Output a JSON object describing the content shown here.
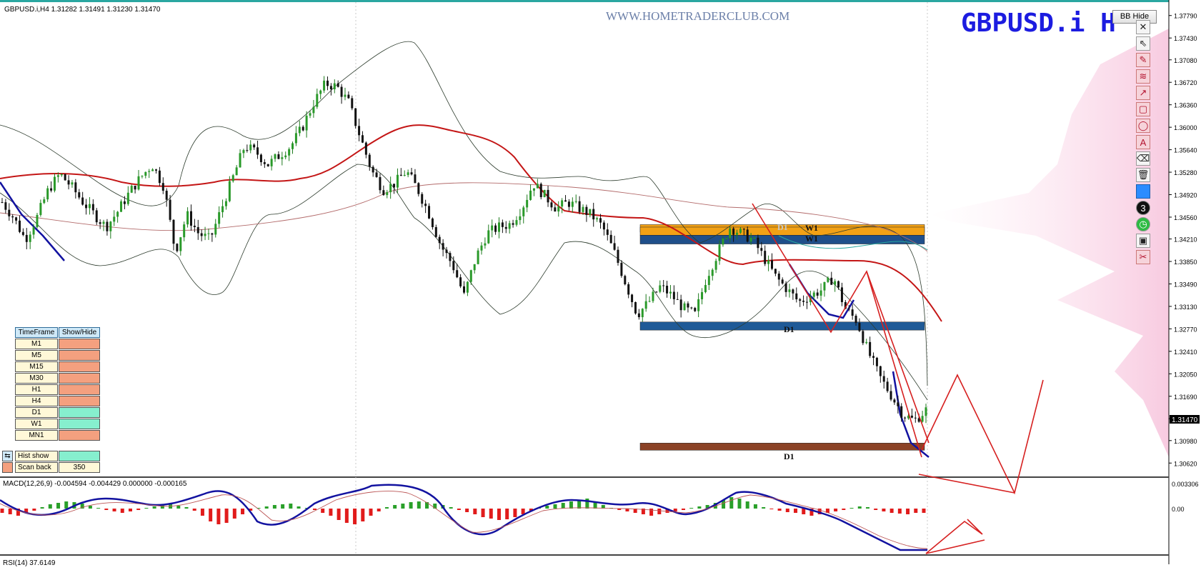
{
  "header": {
    "symbol_info": "GBPUSD.i,H4  1.31282 1.31491 1.31230 1.31470",
    "watermark": "WWW.HOMETRADERCLUB.COM",
    "big_symbol": "GBPUSD.i  H",
    "bb_hide_label": "BB Hide"
  },
  "chart_data": {
    "type": "candlestick",
    "symbol": "GBPUSD.i",
    "timeframe": "H4",
    "ohlc_last": {
      "open": 1.31282,
      "high": 1.31491,
      "low": 1.3123,
      "close": 1.3147
    },
    "price_axis_labels": [
      "1.37790",
      "1.37430",
      "1.37080",
      "1.36720",
      "1.36360",
      "1.36000",
      "1.35640",
      "1.35280",
      "1.34920",
      "1.34560",
      "1.34210",
      "1.33850",
      "1.33490",
      "1.33130",
      "1.32770",
      "1.32410",
      "1.32050",
      "1.31690",
      "1.31330",
      "1.30980",
      "1.30620"
    ],
    "ylim": [
      1.3044,
      1.3797
    ],
    "current_price_label": "1.31470",
    "close_path": [
      1.348,
      1.3455,
      1.342,
      1.3455,
      1.35,
      1.3525,
      1.3505,
      1.348,
      1.346,
      1.344,
      1.3465,
      1.3495,
      1.352,
      1.354,
      1.3505,
      1.34,
      1.346,
      1.343,
      1.342,
      1.347,
      1.352,
      1.357,
      1.356,
      1.354,
      1.3555,
      1.357,
      1.36,
      1.364,
      1.367,
      1.3665,
      1.364,
      1.3585,
      1.353,
      1.35,
      1.351,
      1.353,
      1.35,
      1.346,
      1.341,
      1.338,
      1.333,
      1.339,
      1.343,
      1.344,
      1.3445,
      1.347,
      1.351,
      1.349,
      1.347,
      1.348,
      1.347,
      1.346,
      1.344,
      1.34,
      1.335,
      1.33,
      1.332,
      1.3345,
      1.333,
      1.331,
      1.33,
      1.336,
      1.34,
      1.344,
      1.343,
      1.342,
      1.339,
      1.336,
      1.334,
      1.332,
      1.333,
      1.334,
      1.336,
      1.331,
      1.329,
      1.324,
      1.32,
      1.317,
      1.314,
      1.313,
      1.3147
    ],
    "zones": [
      {
        "label": "D1",
        "price_top": 1.3444,
        "price_bottom": 1.3432,
        "color": "#f2a115"
      },
      {
        "label": "W1",
        "price_top": 1.344,
        "price_bottom": 1.3427,
        "color": "#f2a115"
      },
      {
        "label": "W1",
        "price_top": 1.3427,
        "price_bottom": 1.3413,
        "color": "#1f4f8a"
      },
      {
        "label": "D1",
        "price_top": 1.3288,
        "price_bottom": 1.3275,
        "color": "#1f5a97"
      },
      {
        "label": "D1",
        "price_top": 1.3094,
        "price_bottom": 1.3083,
        "color": "#8b4226"
      }
    ],
    "indicators": {
      "macd_label": "MACD(12,26,9) -0.004594 -0.004429 0.000000 -0.000165",
      "macd_axis_labels": [
        "0.003306",
        "0.00"
      ],
      "rsi_label": "RSI(14) 37.6149"
    }
  },
  "timeframe_panel": {
    "header": {
      "name": "TimeFrame",
      "value": "Show/Hide"
    },
    "rows": [
      {
        "name": "M1",
        "color": "#f4a07f"
      },
      {
        "name": "M5",
        "color": "#f4a07f"
      },
      {
        "name": "M15",
        "color": "#f4a07f"
      },
      {
        "name": "M30",
        "color": "#f4a07f"
      },
      {
        "name": "H1",
        "color": "#f4a07f"
      },
      {
        "name": "H4",
        "color": "#f4a07f"
      },
      {
        "name": "D1",
        "color": "#86efce"
      },
      {
        "name": "W1",
        "color": "#86efce"
      },
      {
        "name": "MN1",
        "color": "#f4a07f"
      }
    ],
    "hist_show_label": "Hist show",
    "hist_show_color": "#86efce",
    "scan_back_label": "Scan back",
    "scan_back_value": "350"
  },
  "toolbar": {
    "icons": [
      "close-icon",
      "cursor-icon",
      "pencil-icon",
      "zigzag-icon",
      "arrow-icon",
      "rectangle-icon",
      "ellipse-icon",
      "text-icon",
      "eraser-icon",
      "trash-icon",
      "color-icon",
      "line-width-icon",
      "clock-icon",
      "screenshot-icon",
      "scissors-icon"
    ],
    "close_glyph": "✕",
    "text_glyph": "A",
    "number_glyph": "3"
  }
}
